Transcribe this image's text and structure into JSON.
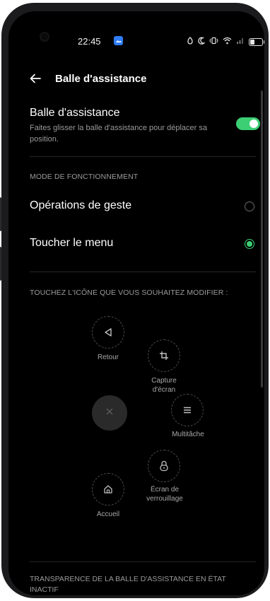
{
  "status_bar": {
    "time": "22:45"
  },
  "header": {
    "title": "Balle d'assistance"
  },
  "assist_ball": {
    "title": "Balle d'assistance",
    "subtitle": "Faites glisser la balle d'assistance pour déplacer sa position.",
    "enabled": true
  },
  "mode_section": {
    "heading": "MODE DE FONCTIONNEMENT",
    "options": [
      {
        "label": "Opérations de geste",
        "selected": false
      },
      {
        "label": "Toucher le menu",
        "selected": true
      }
    ]
  },
  "icons_section": {
    "heading": "TOUCHEZ L'ICÔNE QUE VOUS SOUHAITEZ MODIFIER :",
    "items": [
      {
        "label": "Retour",
        "icon": "back-icon"
      },
      {
        "label": "Capture d'écran",
        "icon": "crop-icon"
      },
      {
        "label": "Multitâche",
        "icon": "menu-icon"
      },
      {
        "label": "Écran de verrouillage",
        "icon": "lock-icon"
      },
      {
        "label": "Accueil",
        "icon": "home-icon"
      }
    ]
  },
  "transparency_section": {
    "heading": "TRANSPARENCE DE LA BALLE D'ASSISTANCE EN ÉTAT INACTIF"
  },
  "colors": {
    "accent": "#3ccf73",
    "background": "#000000"
  }
}
